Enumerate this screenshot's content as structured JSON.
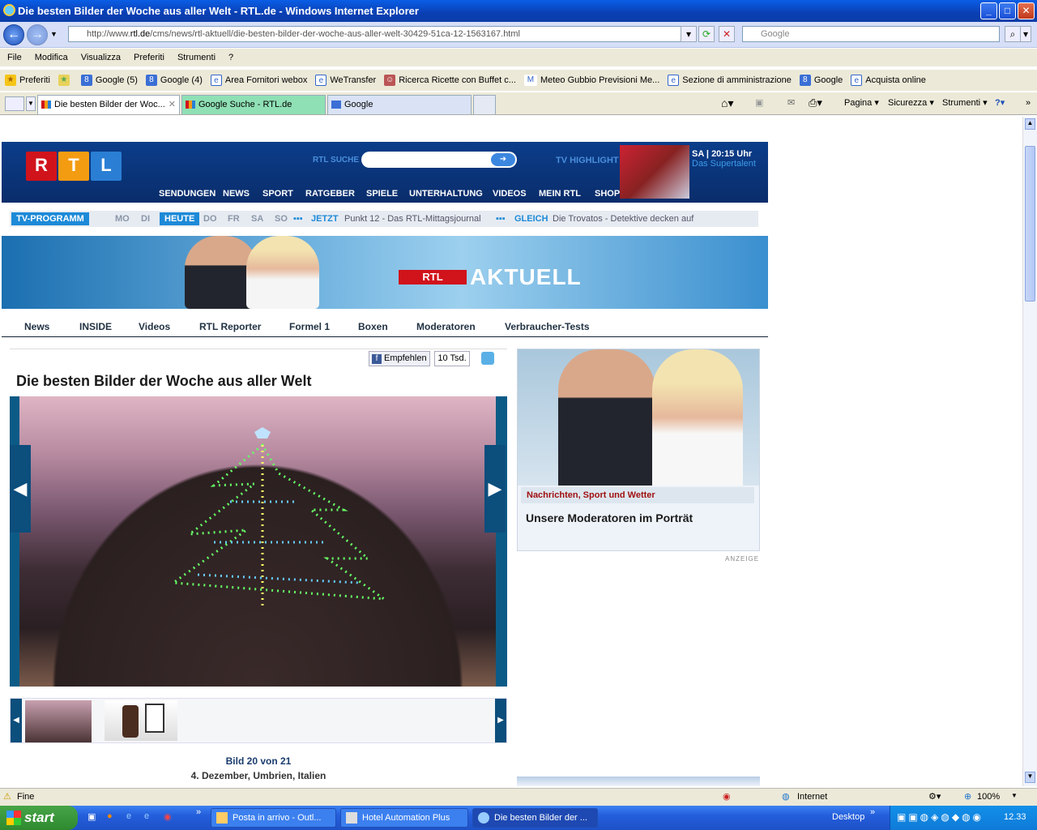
{
  "window": {
    "title": "Die besten Bilder der Woche aus aller Welt - RTL.de - Windows Internet Explorer"
  },
  "nav": {
    "url_prefix": "http://www.",
    "url_domain": "rtl.de",
    "url_rest": "/cms/news/rtl-aktuell/die-besten-bilder-der-woche-aus-aller-welt-30429-51ca-12-1563167.html",
    "search_placeholder": "Google"
  },
  "menu": [
    "File",
    "Modifica",
    "Visualizza",
    "Preferiti",
    "Strumenti",
    "?"
  ],
  "favorites": {
    "label": "Preferiti",
    "items": [
      "Google (5)",
      "Google (4)",
      "Area Fornitori webox",
      "WeTransfer",
      "Ricerca Ricette con Buffet c...",
      "Meteo Gubbio  Previsioni Me...",
      "Sezione di amministrazione",
      "Google",
      "Acquista online"
    ]
  },
  "tabs": [
    {
      "label": "Die besten Bilder der Woc..."
    },
    {
      "label": "Google Suche - RTL.de"
    },
    {
      "label": "Google"
    }
  ],
  "commands": [
    "Pagina",
    "Sicurezza",
    "Strumenti"
  ],
  "rtl": {
    "logo": [
      "R",
      "T",
      "L"
    ],
    "suche_label": "RTL SUCHE",
    "tv_highlight_label": "TV HIGHLIGHT",
    "highlight_time": "SA | 20:15 Uhr",
    "highlight_show": "Das Supertalent",
    "nav": [
      "SENDUNGEN",
      "NEWS",
      "SPORT",
      "RATGEBER",
      "SPIELE",
      "UNTERHALTUNG",
      "VIDEOS",
      "MEIN RTL",
      "SHOP"
    ]
  },
  "tvprogram": {
    "label": "TV-PROGRAMM",
    "days": [
      "MO",
      "DI",
      "HEUTE",
      "DO",
      "FR",
      "SA",
      "SO"
    ],
    "jetzt_label": "JETZT",
    "jetzt_show": "Punkt 12 - Das RTL-Mittagsjournal",
    "gleich_label": "GLEICH",
    "gleich_show": "Die Trovatos - Detektive decken auf"
  },
  "banner": {
    "logo": "RTL",
    "title": "AKTUELL"
  },
  "subnav": [
    "News",
    "INSIDE",
    "Videos",
    "RTL Reporter",
    "Formel 1",
    "Boxen",
    "Moderatoren",
    "Verbraucher-Tests"
  ],
  "article": {
    "share_label": "Empfehlen",
    "share_count": "10 Tsd.",
    "title": "Die besten Bilder der Woche aus aller Welt",
    "caption_index": "Bild 20 von 21",
    "caption_text": "4. Dezember, Umbrien, Italien"
  },
  "sidebar": {
    "category": "Nachrichten, Sport und Wetter",
    "headline": "Unsere Moderatoren im Porträt",
    "ad_label": "ANZEIGE"
  },
  "status": {
    "text": "Fine",
    "zone": "Internet",
    "zoom": "100%"
  },
  "taskbar": {
    "start": "start",
    "tasks": [
      "Posta in arrivo - Outl...",
      "Hotel Automation Plus",
      "Die besten Bilder der ..."
    ],
    "desktop": "Desktop",
    "clock": "12.33"
  }
}
